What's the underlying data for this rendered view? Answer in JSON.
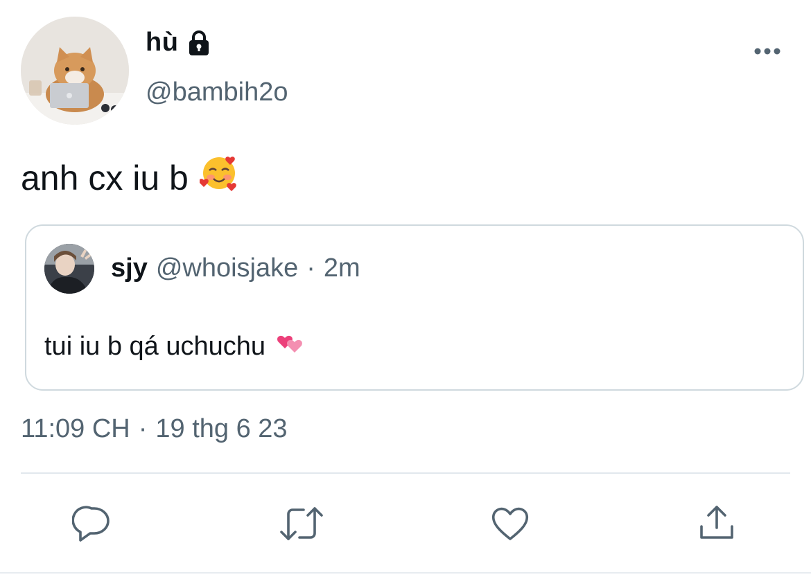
{
  "user": {
    "display_name": "hù",
    "handle": "@bambih2o",
    "protected_icon": "lock-icon"
  },
  "tweet": {
    "text": "anh cx iu b",
    "emoji": "🥰"
  },
  "quoted": {
    "name": "sjy",
    "handle": "@whoisjake",
    "separator": "·",
    "time": "2m",
    "text": "tui iu b qá uchuchu",
    "emoji": "💞"
  },
  "meta": {
    "time": "11:09 CH",
    "separator": "·",
    "date": "19 thg 6 23"
  },
  "actions": {
    "reply_icon": "reply-icon",
    "retweet_icon": "retweet-icon",
    "like_icon": "heart-icon",
    "share_icon": "share-icon"
  },
  "colors": {
    "text_primary": "#0f1419",
    "text_secondary": "#536471",
    "border": "#cfd9de",
    "divider": "#e1e8ed"
  }
}
